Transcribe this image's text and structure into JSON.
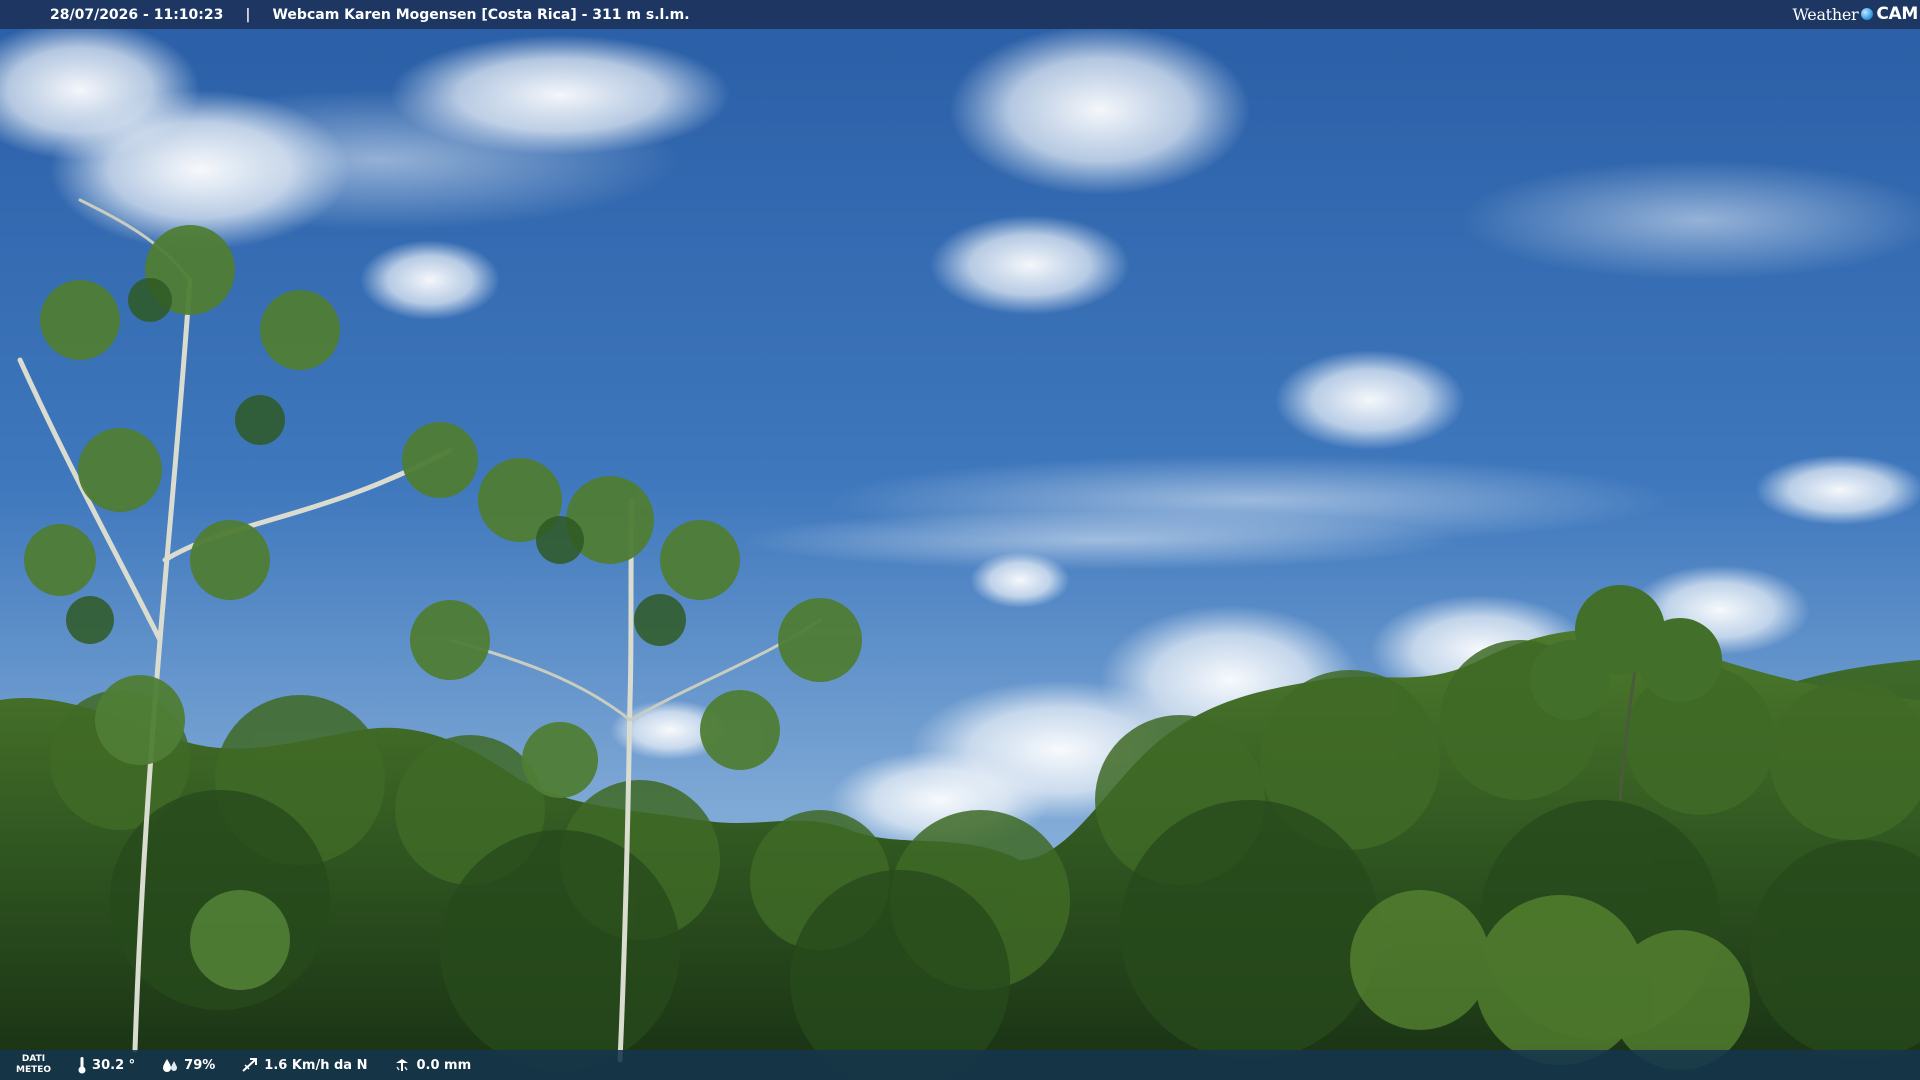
{
  "overlay": {
    "timestamp": "28/07/2026 - 11:10:23",
    "separator": "|",
    "title": "Webcam Karen Mogensen [Costa Rica] - 311 m s.l.m.",
    "brand": {
      "weather": "Weather",
      "cam": "CAM"
    }
  },
  "weather_data": {
    "label_line1": "DATI",
    "label_line2": "METEO",
    "temperature": "30.2 °",
    "humidity": "79%",
    "wind": "1.6 Km/h da N",
    "rain": "0.0 mm"
  },
  "colors": {
    "sky_top": "#2a5ea6",
    "sky_horizon": "#8fb8e0",
    "forest_dark": "#1f3d1a",
    "forest_light": "#4f7a2e",
    "bar_top": "#1c345c",
    "bar_bottom": "#14344c"
  }
}
